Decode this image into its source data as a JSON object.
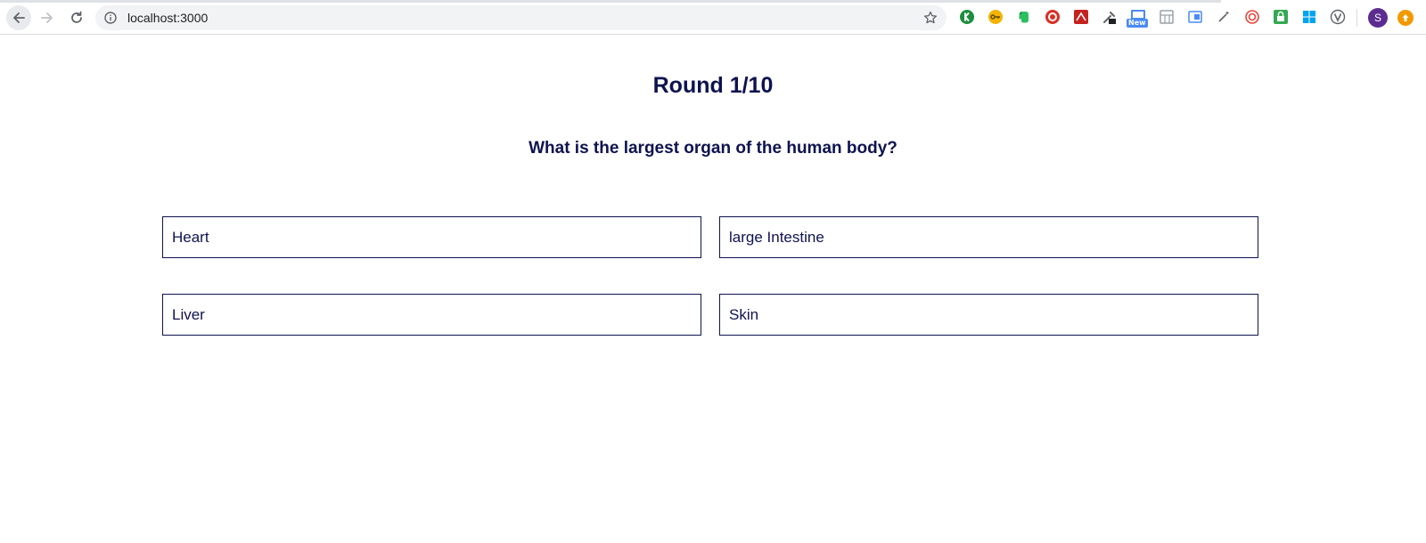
{
  "browser": {
    "url": "localhost:3000",
    "avatar_letter": "S",
    "new_badge": "New",
    "extensions": [
      {
        "icon": "k-extension-icon",
        "color": "#1e8e3e"
      },
      {
        "icon": "key-extension-icon",
        "color": "#f4b400"
      },
      {
        "icon": "evernote-icon",
        "color": "#2dbe60"
      },
      {
        "icon": "target-extension-icon",
        "color": "#d93025"
      },
      {
        "icon": "red-app-extension-icon",
        "color": "#c5221f"
      },
      {
        "icon": "eyedropper-extension-icon",
        "color": "#5f6368"
      },
      {
        "icon": "screenshot-extension-icon",
        "color": "#4a8af4"
      },
      {
        "icon": "grid-extension-icon",
        "color": "#9aa0a6"
      },
      {
        "icon": "window-extension-icon",
        "color": "#4a8af4"
      },
      {
        "icon": "wand-extension-icon",
        "color": "#5f6368"
      },
      {
        "icon": "spiral-extension-icon",
        "color": "#e8453c"
      },
      {
        "icon": "lock-extension-icon",
        "color": "#34a853"
      },
      {
        "icon": "windows-extension-icon",
        "color": "#00a4ef"
      },
      {
        "icon": "v-extension-icon",
        "color": "#5f6368"
      }
    ]
  },
  "quiz": {
    "round_label": "Round 1/10",
    "question": "What is the largest organ of the human body?",
    "answers": [
      "Heart",
      "large Intestine",
      "Liver",
      "Skin"
    ]
  },
  "colors": {
    "primary_text": "#0e134f",
    "answer_border": "#0e134f"
  }
}
